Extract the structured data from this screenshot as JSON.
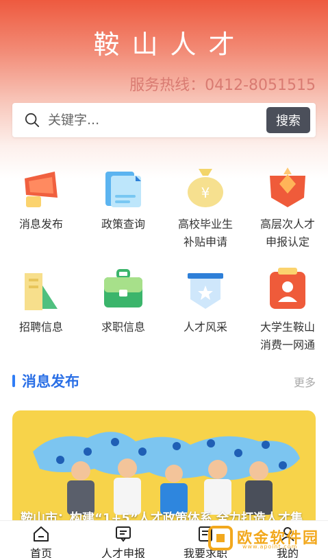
{
  "header": {
    "title": "鞍山人才",
    "hotline": "服务热线：0412-8051515"
  },
  "search": {
    "placeholder": "关键字...",
    "button_label": "搜索"
  },
  "services": [
    {
      "label": "消息发布",
      "icon": "megaphone-icon"
    },
    {
      "label": "政策查询",
      "icon": "document-icon"
    },
    {
      "label": "高校毕业生\n补贴申请",
      "icon": "money-bag-icon"
    },
    {
      "label": "高层次人才\n申报认定",
      "icon": "diamond-badge-icon"
    },
    {
      "label": "招聘信息",
      "icon": "chart-buildings-icon"
    },
    {
      "label": "求职信息",
      "icon": "briefcase-icon"
    },
    {
      "label": "人才风采",
      "icon": "star-shield-icon"
    },
    {
      "label": "大学生鞍山\n消费一网通",
      "icon": "id-card-icon"
    }
  ],
  "news_section": {
    "title": "消息发布",
    "more_label": "更多",
    "card_caption": "鞍山市：构建“1+5”人才政策体系 全力打造人才集"
  },
  "tabbar": {
    "items": [
      {
        "label": "首页",
        "icon": "home-icon"
      },
      {
        "label": "人才申报",
        "icon": "message-icon"
      },
      {
        "label": "我要求职",
        "icon": "job-icon"
      },
      {
        "label": "我的",
        "icon": "user-icon"
      }
    ]
  },
  "watermark": {
    "text": "欧金软件园",
    "sub": "www.apoint.com"
  },
  "colors": {
    "brand_red": "#ee5a3f",
    "accent_blue": "#2a6fe6",
    "button_dark": "#4b4f5a"
  }
}
